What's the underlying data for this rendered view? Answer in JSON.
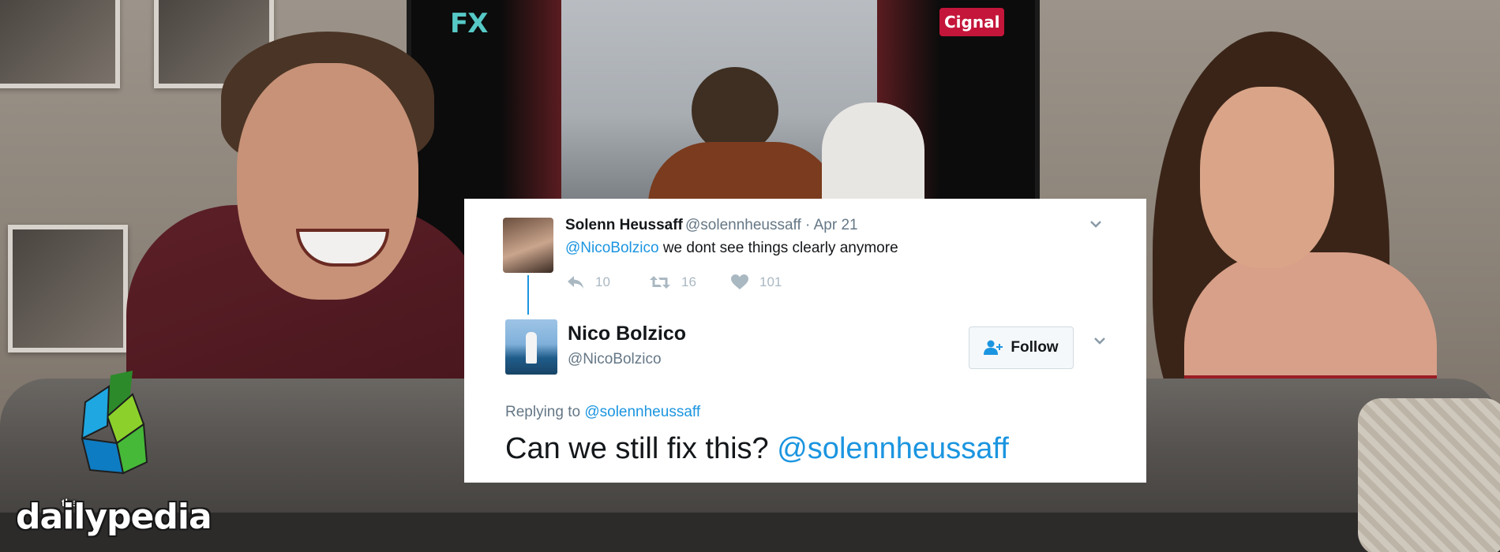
{
  "tv": {
    "channel_logo": "FX",
    "provider_logo": "Cignal"
  },
  "watermark": {
    "small": "the",
    "brand": "dailypedia"
  },
  "tweet_original": {
    "display_name": "Solenn Heussaff",
    "handle": "@solennheussaff",
    "separator": "·",
    "date": "Apr 21",
    "mention": "@NicoBolzico",
    "text": " we dont see things clearly anymore",
    "replies": "10",
    "retweets": "16",
    "likes": "101",
    "icons": {
      "reply": "reply-icon",
      "retweet": "retweet-icon",
      "like": "heart-icon",
      "menu": "chevron-down-icon"
    }
  },
  "tweet_reply": {
    "display_name": "Nico Bolzico",
    "handle": "@NicoBolzico",
    "follow_label": "Follow",
    "replying_prefix": "Replying to ",
    "replying_to": "@solennheussaff",
    "text": "Can we still fix this? ",
    "mention": "@solennheussaff",
    "icons": {
      "follow": "add-user-icon",
      "menu": "chevron-down-icon"
    }
  },
  "colors": {
    "link": "#1b95e0",
    "muted": "#657786",
    "action": "#aab8c2",
    "cignal": "#c4163a",
    "fx": "#56c9c6"
  }
}
